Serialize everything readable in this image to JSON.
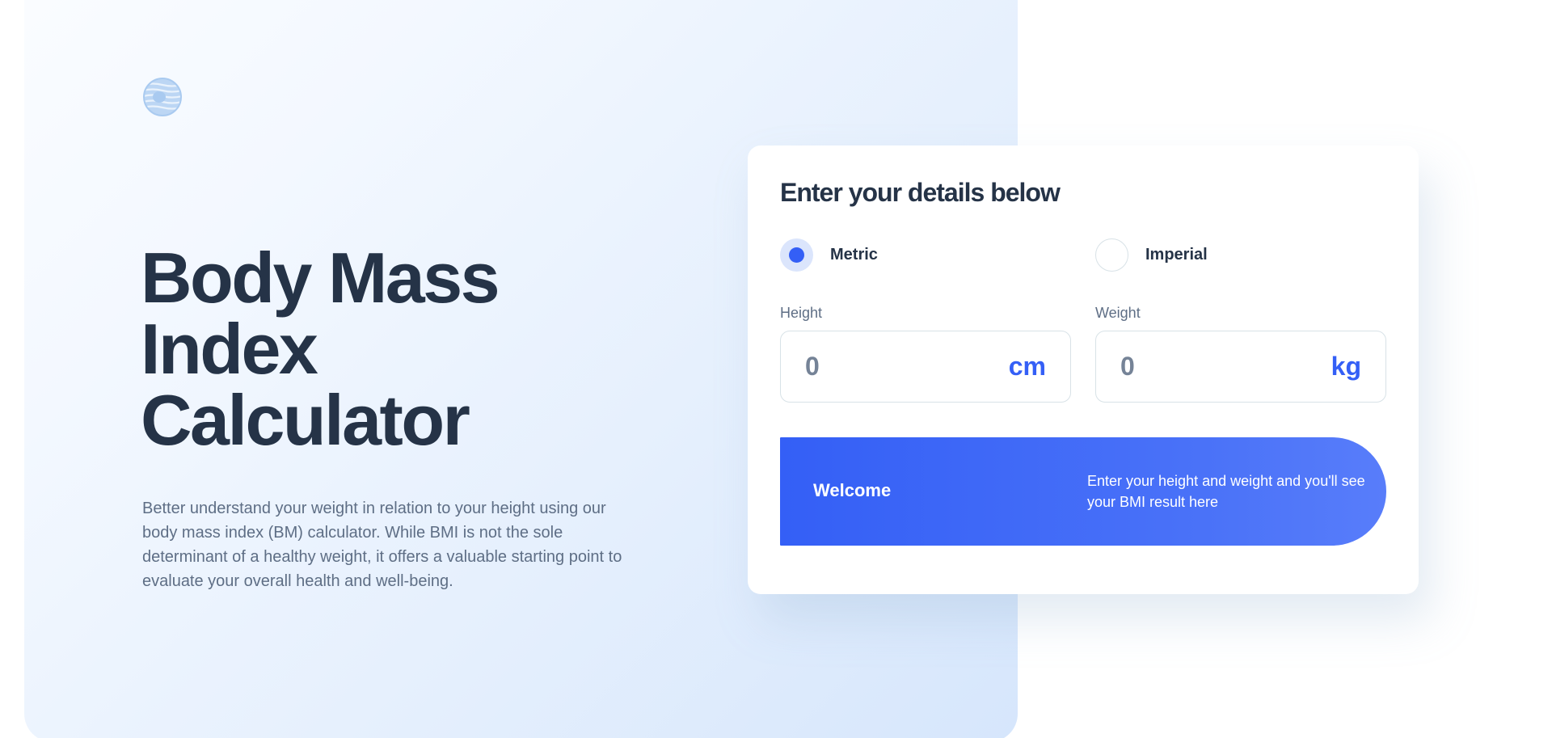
{
  "hero": {
    "title_lines": [
      "Body Mass",
      "Index",
      "Calculator"
    ],
    "description": "Better understand your weight in relation to your height using our body mass index (BM) calculator. While BMI is not the sole determinant of a healthy weight, it offers a valuable starting point to evaluate your overall health and well-being."
  },
  "card": {
    "title": "Enter your details below",
    "units": [
      {
        "label": "Metric",
        "checked": true
      },
      {
        "label": "Imperial",
        "checked": false
      }
    ],
    "height": {
      "label": "Height",
      "value": "0",
      "unit": "cm"
    },
    "weight": {
      "label": "Weight",
      "value": "0",
      "unit": "kg"
    },
    "result": {
      "title": "Welcome",
      "text": "Enter your height and weight and you'll see your BMI result here"
    }
  },
  "colors": {
    "accent": "#345ff6",
    "heading": "#253347",
    "body_text": "#5e6e85",
    "border": "#d8e2e7"
  },
  "icons": {
    "logo": "striped-circle-logo-icon"
  }
}
